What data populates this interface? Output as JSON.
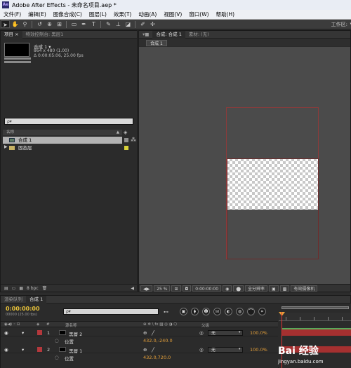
{
  "window": {
    "title": "Adobe After Effects - 未命名项目.aep *",
    "app_icon": "Ae"
  },
  "menu": [
    "文件(F)",
    "编辑(E)",
    "图像合成(C)",
    "图层(L)",
    "效果(T)",
    "动画(A)",
    "视图(V)",
    "窗口(W)",
    "帮助(H)"
  ],
  "toolbar": {
    "workspace_label": "工作区:",
    "tools": [
      "selection-tool",
      "hand-tool",
      "zoom-tool",
      "rotate-tool",
      "camera-tool",
      "pan-behind-tool",
      "rectangle-tool",
      "pen-tool",
      "type-tool",
      "brush-tool",
      "clone-stamp-tool",
      "eraser-tool",
      "roto-brush-tool",
      "puppet-tool"
    ]
  },
  "project": {
    "tabs": [
      "项目 ×",
      "特效控制台: 黑层1"
    ],
    "item_name": "合成 1 ▾",
    "item_size": "864 x 480 (1.00)",
    "item_duration": "Δ 0:00:05:06, 25.00 fps",
    "search_placeholder": "ρ▾",
    "column_name": "名称",
    "rows": [
      "合成 1",
      "固态层"
    ],
    "bpc": "8 bpc"
  },
  "composition": {
    "tabs": [
      "合成: 合成 1",
      "素材: (无)"
    ],
    "subtab": "合成 1",
    "zoom": "25 %",
    "timecode": "0:00:00:00",
    "resolution": "全分辨率",
    "camera": "有效摄像机"
  },
  "timeline": {
    "tabs": [
      "渲染队列",
      "合成 1"
    ],
    "timecode": "0:00:00:00",
    "timecode_sub": "00000 (25.00 fps)",
    "search_placeholder": "ρ▾",
    "header": {
      "num": "#",
      "source": "源名称",
      "parent": "父级"
    },
    "layers": [
      {
        "num": "1",
        "name": "黑層 2",
        "parent": "无",
        "position_label": "位置",
        "position": "432.0,-240.0",
        "pct": "100.0%"
      },
      {
        "num": "2",
        "name": "黑層 1",
        "parent": "无",
        "position_label": "位置",
        "position": "432.0,720.0",
        "pct": "100.0%"
      }
    ]
  },
  "watermark": {
    "logo": "Bai 经验",
    "url": "jingyan.baidu.com"
  }
}
